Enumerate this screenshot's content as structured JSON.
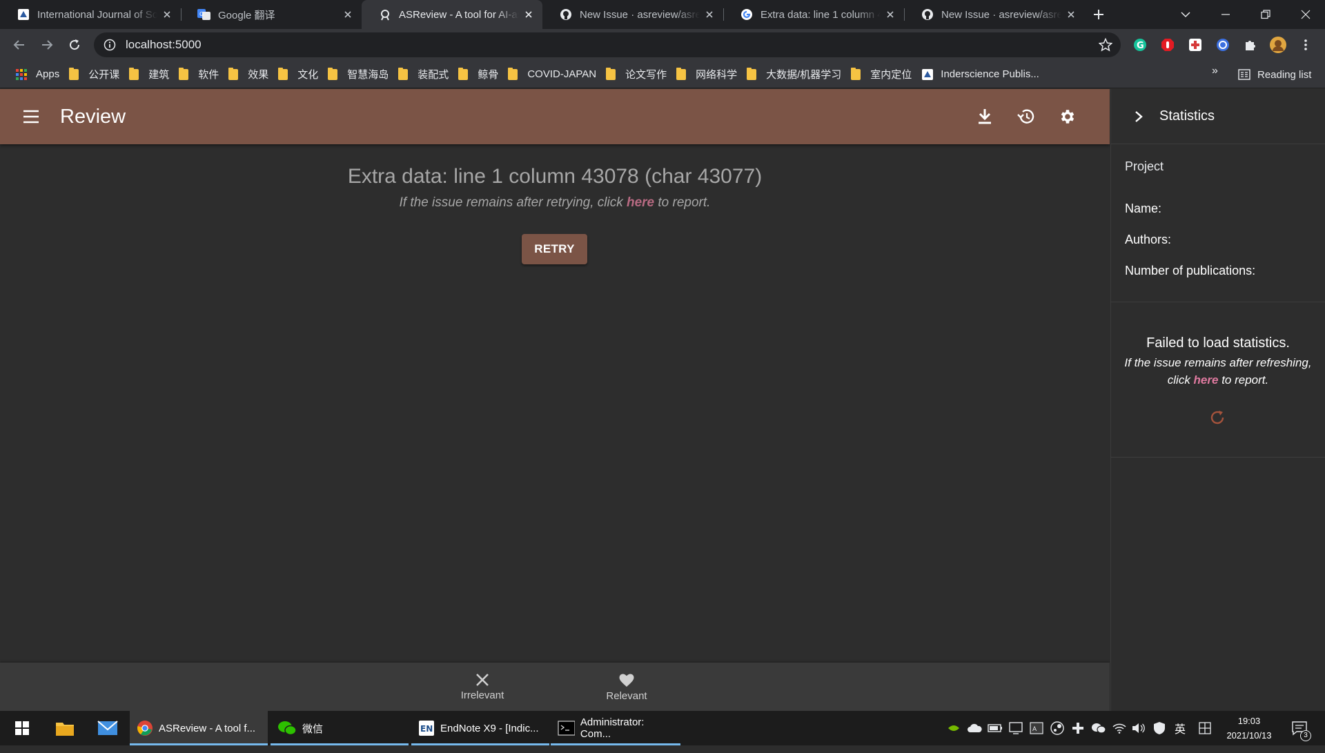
{
  "browser": {
    "tabs": [
      {
        "title": "International Journal of Soc",
        "icon": "journal-favicon"
      },
      {
        "title": "Google 翻译",
        "icon": "google-translate-favicon"
      },
      {
        "title": "ASReview - A tool for AI-ass",
        "icon": "asreview-favicon",
        "active": true
      },
      {
        "title": "New Issue · asreview/asrevi",
        "icon": "github-favicon"
      },
      {
        "title": "Extra data: line 1 column 4",
        "icon": "google-favicon"
      },
      {
        "title": "New Issue · asreview/asrevi",
        "icon": "github-favicon"
      }
    ],
    "url": "localhost:5000",
    "bookmarks": [
      {
        "label": "Apps",
        "icon": "apps-grid-icon"
      },
      {
        "label": "公开课",
        "icon": "folder-icon"
      },
      {
        "label": "建筑",
        "icon": "folder-icon"
      },
      {
        "label": "软件",
        "icon": "folder-icon"
      },
      {
        "label": "效果",
        "icon": "folder-icon"
      },
      {
        "label": "文化",
        "icon": "folder-icon"
      },
      {
        "label": "智慧海岛",
        "icon": "folder-icon"
      },
      {
        "label": "装配式",
        "icon": "folder-icon"
      },
      {
        "label": "鲸骨",
        "icon": "folder-icon"
      },
      {
        "label": "COVID-JAPAN",
        "icon": "folder-icon"
      },
      {
        "label": "论文写作",
        "icon": "folder-icon"
      },
      {
        "label": "网络科学",
        "icon": "folder-icon"
      },
      {
        "label": "大数据/机器学习",
        "icon": "folder-icon"
      },
      {
        "label": "室内定位",
        "icon": "folder-icon"
      },
      {
        "label": "Inderscience Publis...",
        "icon": "inderscience-favicon"
      }
    ],
    "bookmarks_more": "»",
    "reading_list": "Reading list"
  },
  "app": {
    "title": "Review",
    "error": {
      "title": "Extra data: line 1 column 43078 (char 43077)",
      "sub_before": "If the issue remains after retrying, click ",
      "sub_link": "here",
      "sub_after": " to report."
    },
    "retry_label": "RETRY",
    "decision": {
      "irrelevant": "Irrelevant",
      "relevant": "Relevant"
    },
    "colors": {
      "accent": "#7b5446",
      "link": "#b86a82"
    }
  },
  "side": {
    "title": "Statistics",
    "project_heading": "Project",
    "name_label": "Name:",
    "authors_label": "Authors:",
    "pubs_label": "Number of publications:",
    "fail_title": "Failed to load statistics.",
    "fail_sub_before": "If the issue remains after refreshing,",
    "fail_sub_click": "click ",
    "fail_sub_link": "here",
    "fail_sub_after": " to report."
  },
  "taskbar": {
    "apps": [
      {
        "label": "ASReview - A tool f...",
        "icon": "chrome-icon",
        "active": true
      },
      {
        "label": "微信",
        "icon": "wechat-icon"
      },
      {
        "label": "EndNote X9 - [Indic...",
        "icon": "endnote-icon"
      },
      {
        "label": "Administrator: Com...",
        "icon": "cmd-icon"
      }
    ],
    "ime": "英",
    "time": "19:03",
    "date": "2021/10/13",
    "notifications": "3"
  }
}
